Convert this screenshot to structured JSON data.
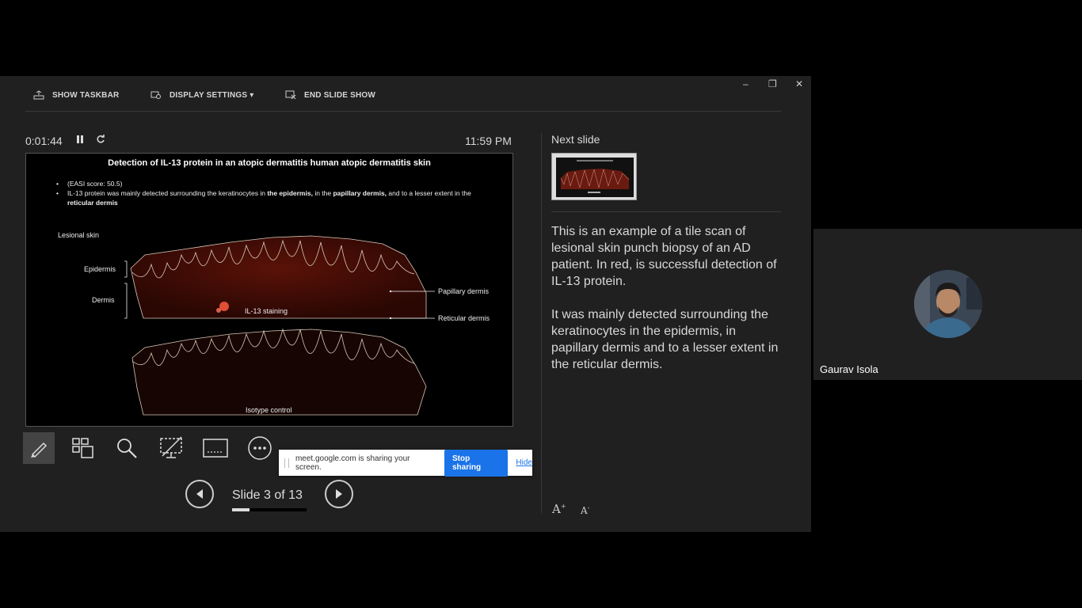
{
  "toolbar": {
    "show_taskbar": "SHOW TASKBAR",
    "display_settings": "DISPLAY SETTINGS ▾",
    "end_slide_show": "END SLIDE SHOW"
  },
  "window": {
    "minimize": "–",
    "restore": "❐",
    "close": "✕"
  },
  "timer": "0:01:44",
  "clock": "11:59 PM",
  "slide": {
    "title": "Detection of IL-13 protein in an atopic dermatitis human atopic dermatitis skin",
    "bullet1": "(EASI score: 50.5)",
    "bullet2_a": "IL-13 protein was mainly detected surrounding the keratinocytes in ",
    "bullet2_b": "the epidermis,",
    "bullet2_c": "  in the ",
    "bullet2_d": "papillary dermis,",
    "bullet2_e": " and to a lesser extent in the ",
    "bullet2_f": "reticular dermis",
    "lesional_skin": "Lesional skin",
    "epidermis": "Epidermis",
    "dermis": "Dermis",
    "il13_staining": "IL-13 staining",
    "papillary_dermis": "Papillary dermis",
    "reticular_dermis": "Reticular dermis",
    "isotype_control": "Isotype control"
  },
  "navigation": {
    "slide_counter": "Slide 3 of 13",
    "progress_fraction": 0.23
  },
  "next_slide": {
    "label": "Next slide"
  },
  "notes": {
    "paragraph1": "This is an example of a tile scan of lesional skin punch biopsy of an AD patient. In red, is successful detection of IL-13 protein.",
    "paragraph2": "It was mainly detected surrounding the keratinocytes in the epidermis, in papillary dermis and to a lesser extent in the reticular dermis."
  },
  "font_controls": {
    "increase": "A",
    "decrease": "A"
  },
  "share_bar": {
    "message": "meet.google.com is sharing your screen.",
    "stop_label": "Stop sharing",
    "hide_label": "Hide"
  },
  "participant": {
    "name": "Gaurav Isola"
  },
  "colors": {
    "accent": "#1a73e8",
    "background": "#202020",
    "tissue": "#3a0a05"
  }
}
